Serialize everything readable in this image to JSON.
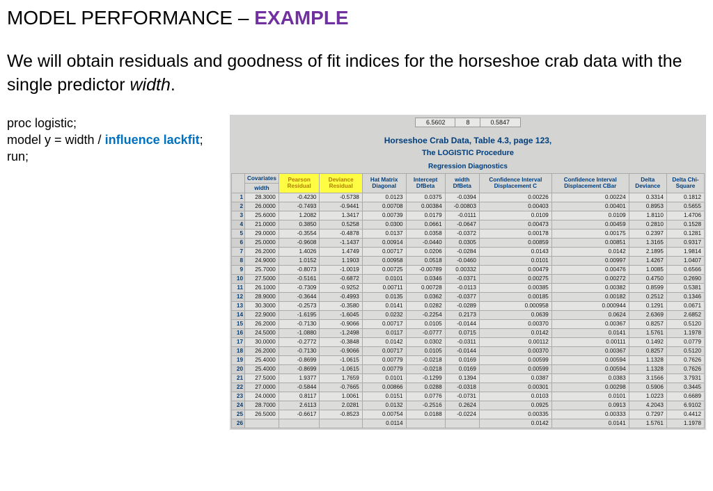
{
  "title_prefix": "MODEL PERFORMANCE – ",
  "title_highlight": "EXAMPLE",
  "description_a": "We will obtain residuals and goodness of fit indices for the horseshoe crab data with the single predictor ",
  "description_italic": "width",
  "description_b": ".",
  "code": {
    "line1": "proc logistic;",
    "line2a": "model y = width / ",
    "line2b": "influence lackfit",
    "line2c": ";",
    "line3": "run;"
  },
  "top_numbers": [
    "6.5602",
    "8",
    "0.5847"
  ],
  "output_title": "Horseshoe Crab Data, Table 4.3, page 123,",
  "output_subtitle": "The LOGISTIC Procedure",
  "output_section": "Regression Diagnostics",
  "covariates_label": "Covariates",
  "headers": [
    "width",
    "Pearson Residual",
    "Deviance Residual",
    "Hat Matrix Diagonal",
    "Intercept DfBeta",
    "width DfBeta",
    "Confidence Interval Displacement C",
    "Confidence Interval Displacement CBar",
    "Delta Deviance",
    "Delta Chi-Square"
  ],
  "rows": [
    [
      "1",
      "28.3000",
      "-0.4230",
      "-0.5738",
      "0.0123",
      "0.0375",
      "-0.0394",
      "0.00226",
      "0.00224",
      "0.3314",
      "0.1812"
    ],
    [
      "2",
      "26.0000",
      "-0.7493",
      "-0.9441",
      "0.00708",
      "0.00384",
      "-0.00803",
      "0.00403",
      "0.00401",
      "0.8953",
      "0.5655"
    ],
    [
      "3",
      "25.6000",
      "1.2082",
      "1.3417",
      "0.00739",
      "0.0179",
      "-0.0111",
      "0.0109",
      "0.0109",
      "1.8110",
      "1.4706"
    ],
    [
      "4",
      "21.0000",
      "0.3850",
      "0.5258",
      "0.0300",
      "0.0661",
      "-0.0647",
      "0.00473",
      "0.00459",
      "0.2810",
      "0.1528"
    ],
    [
      "5",
      "29.0000",
      "-0.3554",
      "-0.4878",
      "0.0137",
      "0.0358",
      "-0.0372",
      "0.00178",
      "0.00175",
      "0.2397",
      "0.1281"
    ],
    [
      "6",
      "25.0000",
      "-0.9608",
      "-1.1437",
      "0.00914",
      "-0.0440",
      "0.0305",
      "0.00859",
      "0.00851",
      "1.3165",
      "0.9317"
    ],
    [
      "7",
      "26.2000",
      "1.4026",
      "1.4749",
      "0.00717",
      "0.0206",
      "-0.0284",
      "0.0143",
      "0.0142",
      "2.1895",
      "1.9814"
    ],
    [
      "8",
      "24.9000",
      "1.0152",
      "1.1903",
      "0.00958",
      "0.0518",
      "-0.0460",
      "0.0101",
      "0.00997",
      "1.4267",
      "1.0407"
    ],
    [
      "9",
      "25.7000",
      "-0.8073",
      "-1.0019",
      "0.00725",
      "-0.00789",
      "0.00332",
      "0.00479",
      "0.00476",
      "1.0085",
      "0.6566"
    ],
    [
      "10",
      "27.5000",
      "-0.5161",
      "-0.6872",
      "0.0101",
      "0.0346",
      "-0.0371",
      "0.00275",
      "0.00272",
      "0.4750",
      "0.2690"
    ],
    [
      "11",
      "26.1000",
      "-0.7309",
      "-0.9252",
      "0.00711",
      "0.00728",
      "-0.0113",
      "0.00385",
      "0.00382",
      "0.8599",
      "0.5381"
    ],
    [
      "12",
      "28.9000",
      "-0.3644",
      "-0.4993",
      "0.0135",
      "0.0362",
      "-0.0377",
      "0.00185",
      "0.00182",
      "0.2512",
      "0.1346"
    ],
    [
      "13",
      "30.3000",
      "-0.2573",
      "-0.3580",
      "0.0141",
      "0.0282",
      "-0.0289",
      "0.000958",
      "0.000944",
      "0.1291",
      "0.0671"
    ],
    [
      "14",
      "22.9000",
      "-1.6195",
      "-1.6045",
      "0.0232",
      "-0.2254",
      "0.2173",
      "0.0639",
      "0.0624",
      "2.6369",
      "2.6852"
    ],
    [
      "15",
      "26.2000",
      "-0.7130",
      "-0.9066",
      "0.00717",
      "0.0105",
      "-0.0144",
      "0.00370",
      "0.00367",
      "0.8257",
      "0.5120"
    ],
    [
      "16",
      "24.5000",
      "-1.0880",
      "-1.2498",
      "0.0117",
      "-0.0777",
      "0.0715",
      "0.0142",
      "0.0141",
      "1.5761",
      "1.1978"
    ],
    [
      "17",
      "30.0000",
      "-0.2772",
      "-0.3848",
      "0.0142",
      "0.0302",
      "-0.0311",
      "0.00112",
      "0.00111",
      "0.1492",
      "0.0779"
    ],
    [
      "18",
      "26.2000",
      "-0.7130",
      "-0.9066",
      "0.00717",
      "0.0105",
      "-0.0144",
      "0.00370",
      "0.00367",
      "0.8257",
      "0.5120"
    ],
    [
      "19",
      "25.4000",
      "-0.8699",
      "-1.0615",
      "0.00779",
      "-0.0218",
      "0.0169",
      "0.00599",
      "0.00594",
      "1.1328",
      "0.7626"
    ],
    [
      "20",
      "25.4000",
      "-0.8699",
      "-1.0615",
      "0.00779",
      "-0.0218",
      "0.0169",
      "0.00599",
      "0.00594",
      "1.1328",
      "0.7626"
    ],
    [
      "21",
      "27.5000",
      "1.9377",
      "1.7659",
      "0.0101",
      "-0.1299",
      "0.1394",
      "0.0387",
      "0.0383",
      "3.1566",
      "3.7931"
    ],
    [
      "22",
      "27.0000",
      "-0.5844",
      "-0.7665",
      "0.00866",
      "0.0288",
      "-0.0318",
      "0.00301",
      "0.00298",
      "0.5906",
      "0.3445"
    ],
    [
      "23",
      "24.0000",
      "0.8117",
      "1.0061",
      "0.0151",
      "0.0776",
      "-0.0731",
      "0.0103",
      "0.0101",
      "1.0223",
      "0.6689"
    ],
    [
      "24",
      "28.7000",
      "2.6113",
      "2.0281",
      "0.0132",
      "-0.2516",
      "0.2624",
      "0.0925",
      "0.0913",
      "4.2043",
      "6.9102"
    ],
    [
      "25",
      "26.5000",
      "-0.6617",
      "-0.8523",
      "0.00754",
      "0.0188",
      "-0.0224",
      "0.00335",
      "0.00333",
      "0.7297",
      "0.4412"
    ],
    [
      "26",
      "",
      "",
      "",
      "0.0114",
      "",
      "",
      "0.0142",
      "0.0141",
      "1.5761",
      "1.1978"
    ]
  ]
}
